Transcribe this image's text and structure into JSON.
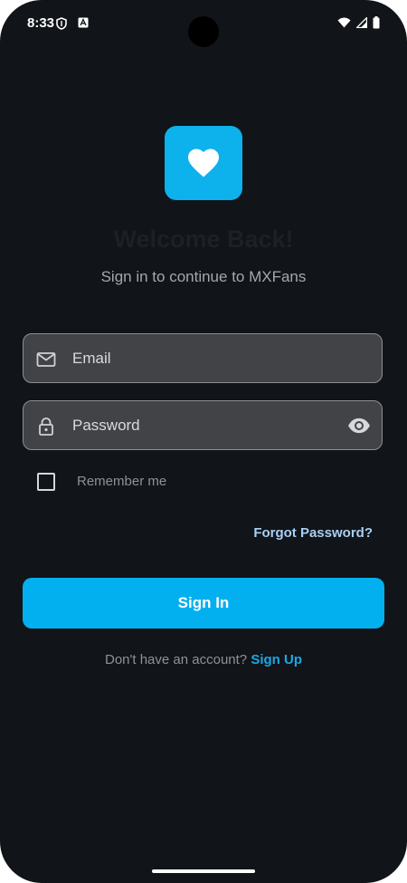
{
  "status_bar": {
    "time": "8:33",
    "left_icons": [
      "shield-icon",
      "app-notification-icon"
    ],
    "right_icons": [
      "wifi-icon",
      "cell-signal-icon",
      "battery-icon"
    ]
  },
  "logo": {
    "icon": "heart-icon",
    "color": "#0db1ec"
  },
  "header": {
    "title": "Welcome Back!",
    "subtitle": "Sign in to continue to MXFans"
  },
  "form": {
    "email": {
      "placeholder": "Email",
      "value": "",
      "icon": "mail-icon"
    },
    "password": {
      "placeholder": "Password",
      "value": "",
      "icon": "lock-icon",
      "toggle_icon": "eye-icon"
    },
    "remember_me": {
      "label": "Remember me",
      "checked": false
    },
    "forgot_password_label": "Forgot Password?",
    "signin_label": "Sign In"
  },
  "footer": {
    "prompt": "Don't have an account?",
    "signup_label": "Sign Up"
  },
  "colors": {
    "background": "#111418",
    "accent": "#03b0ef",
    "link": "#1ba8e6",
    "forgot_link": "#a8cff4"
  }
}
